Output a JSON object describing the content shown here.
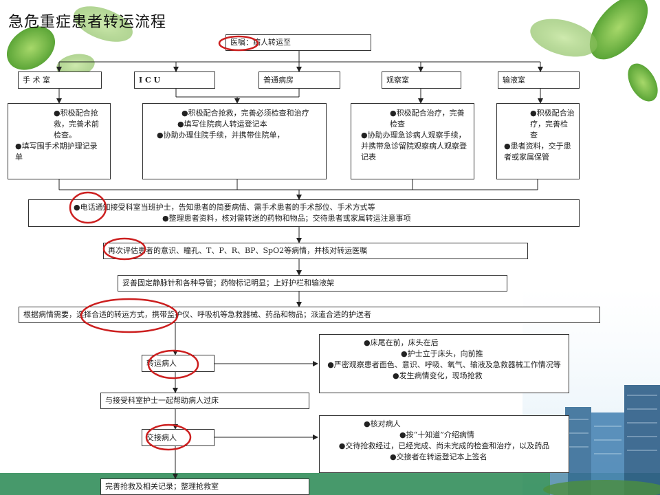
{
  "title": "急危重症患者转运流程",
  "order": "医嘱：病人转运至",
  "departments": [
    "手 术 室",
    "I C U",
    "普通病房",
    "观察室",
    "输液室"
  ],
  "dept_details": {
    "surgery": [
      "●积极配合抢救，完善术前检查。",
      "●填写围手术期护理记录单"
    ],
    "icu": [
      "●积极配合抢救，完善必须检查和治疗",
      "●填写住院病人转运登记本",
      "●协助办理住院手续，并携带住院单，"
    ],
    "ward": [],
    "observation": [
      "●积极配合治疗，完善检查",
      "●协助办理急诊病人观察手续，并携带急诊留院观察病人观察登记表"
    ],
    "infusion": [
      "●积极配合治疗，完善检查",
      "●患者资料，交于患者或家属保管"
    ]
  },
  "steps": {
    "notify_1": "●电话通知接受科室当班护士，告知患者的简要病情、需手术患者的手术部位、手术方式等",
    "notify_2": "●整理患者资料，核对需转送的药物和物品；交待患者或家属转运注意事项",
    "reassess": "再次评估患者的意识、瞳孔、T、P、R、BP、SpO2等病情，并核对转运医嘱",
    "secure": "妥善固定静脉针和各种导管；药物标记明显；上好护栏和输液架",
    "choose": "根据病情需要，选择合适的转运方式，携带监护仪、呼吸机等急救器械、药品和物品；派遣合适的护送者",
    "transport": "转运病人",
    "transfer_bed": "与接受科室护士一起帮助病人过床",
    "handover": "交接病人",
    "final": "完善抢救及相关记录；整理抢救室"
  },
  "transport_notes": [
    "●床尾在前，床头在后",
    "●护士立于床头，向前推",
    "●严密观察患者面色、意识、呼吸、氧气、输液及急救器械工作情况等",
    "●发生病情变化，现场抢救"
  ],
  "handover_notes": [
    "●核对病人",
    "●按“十知道”介绍病情",
    "●交待抢救经过，已经完成、尚未完成的检查和治疗，以及药品",
    "●交接者在转运登记本上签名"
  ],
  "colors": {
    "highlight_circle": "#cc1f1f",
    "bottom_band": "#2e8b57"
  }
}
